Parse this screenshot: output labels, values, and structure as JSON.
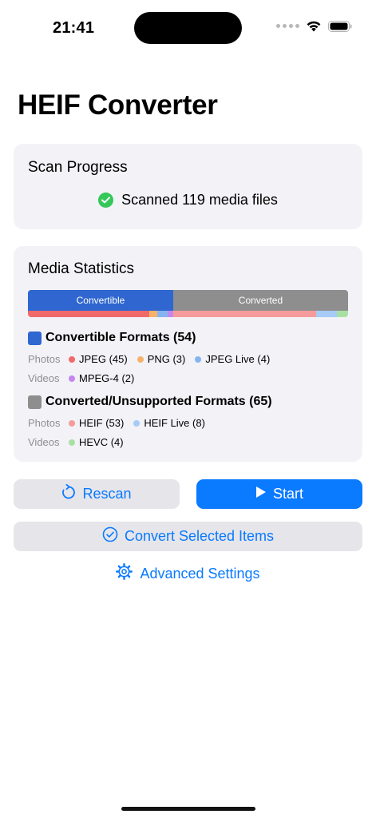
{
  "status_bar": {
    "time": "21:41"
  },
  "page": {
    "title": "HEIF Converter"
  },
  "scan": {
    "title": "Scan Progress",
    "status_text": "Scanned 119 media files"
  },
  "stats": {
    "title": "Media Statistics",
    "bar": {
      "convertible_label": "Convertible",
      "converted_label": "Converted",
      "convertible_fraction": 54,
      "converted_fraction": 65,
      "breakdown": [
        {
          "name": "JPEG",
          "count": 45,
          "color": "#f16a6a"
        },
        {
          "name": "PNG",
          "count": 3,
          "color": "#f6b26b"
        },
        {
          "name": "JPEG Live",
          "count": 4,
          "color": "#86b4f0"
        },
        {
          "name": "MPEG-4",
          "count": 2,
          "color": "#c586f0"
        },
        {
          "name": "HEIF",
          "count": 53,
          "color": "#f59b9b"
        },
        {
          "name": "HEIF Live",
          "count": 8,
          "color": "#a6cbf7"
        },
        {
          "name": "HEVC",
          "count": 4,
          "color": "#a8e0a4"
        }
      ]
    },
    "convertible": {
      "label": "Convertible Formats (54)",
      "color": "#2f66d0",
      "photos_label": "Photos",
      "videos_label": "Videos",
      "photos": [
        {
          "text": "JPEG (45)",
          "color": "#f16a6a"
        },
        {
          "text": "PNG (3)",
          "color": "#f6b26b"
        },
        {
          "text": "JPEG Live (4)",
          "color": "#86b4f0"
        }
      ],
      "videos": [
        {
          "text": "MPEG-4 (2)",
          "color": "#c586f0"
        }
      ]
    },
    "converted": {
      "label": "Converted/Unsupported Formats (65)",
      "color": "#8e8e8e",
      "photos_label": "Photos",
      "videos_label": "Videos",
      "photos": [
        {
          "text": "HEIF (53)",
          "color": "#f59b9b"
        },
        {
          "text": "HEIF Live (8)",
          "color": "#a6cbf7"
        }
      ],
      "videos": [
        {
          "text": "HEVC (4)",
          "color": "#a8e0a4"
        }
      ]
    }
  },
  "actions": {
    "rescan_label": "Rescan",
    "start_label": "Start",
    "convert_selected_label": "Convert Selected Items",
    "advanced_settings_label": "Advanced Settings"
  },
  "colors": {
    "accent": "#0a7aff",
    "success": "#34c759",
    "convertible": "#2f66d0",
    "converted": "#8e8e8e"
  }
}
